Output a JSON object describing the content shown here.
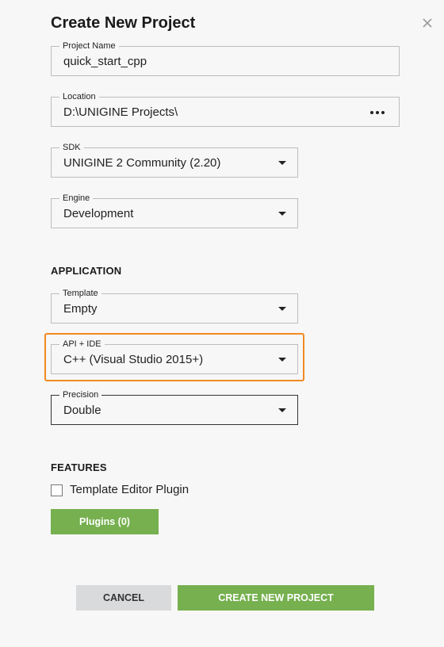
{
  "dialog": {
    "title": "Create New Project"
  },
  "fields": {
    "project_name": {
      "label": "Project Name",
      "value": "quick_start_cpp"
    },
    "location": {
      "label": "Location",
      "value": "D:\\UNIGINE Projects\\"
    },
    "sdk": {
      "label": "SDK",
      "value": "UNIGINE 2 Community (2.20)"
    },
    "engine": {
      "label": "Engine",
      "value": "Development"
    }
  },
  "application": {
    "heading": "APPLICATION",
    "template": {
      "label": "Template",
      "value": "Empty"
    },
    "api_ide": {
      "label": "API + IDE",
      "value": "C++ (Visual Studio 2015+)"
    },
    "precision": {
      "label": "Precision",
      "value": "Double"
    }
  },
  "features": {
    "heading": "FEATURES",
    "template_editor_plugin": {
      "label": "Template Editor Plugin",
      "checked": false
    },
    "plugins_button": "Plugins (0)"
  },
  "actions": {
    "cancel": "CANCEL",
    "create": "CREATE NEW PROJECT"
  },
  "colors": {
    "accent_green": "#76b04f",
    "highlight_orange": "#f08a24",
    "cancel_gray": "#d8dadc"
  },
  "icons": {
    "close": "close-icon",
    "browse": "ellipsis-icon",
    "dropdown": "caret-down-icon"
  }
}
